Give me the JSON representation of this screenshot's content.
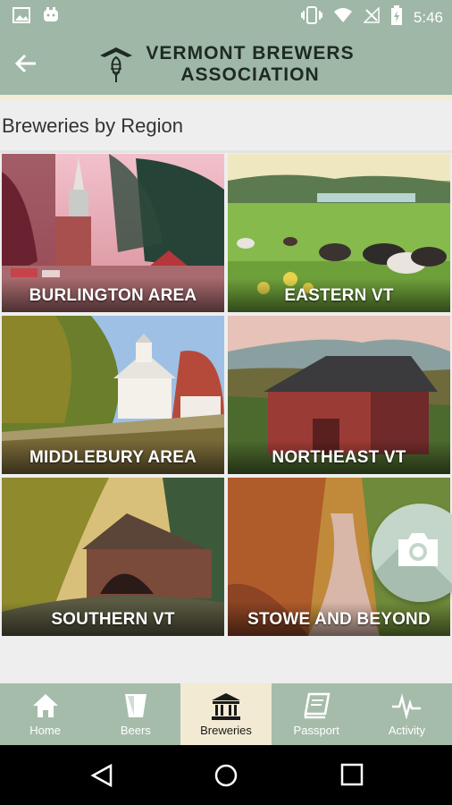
{
  "status_bar": {
    "time": "5:46",
    "icons": [
      "image-icon",
      "notification-app-icon",
      "vibrate-icon",
      "wifi-icon",
      "no-signal-icon",
      "battery-charging-icon"
    ]
  },
  "app_bar": {
    "brand_line1": "VERMONT BREWERS",
    "brand_line2": "ASSOCIATION",
    "back_icon": "arrow-back-icon",
    "logo_icon": "hops-logo-icon"
  },
  "section": {
    "title": "Breweries by Region"
  },
  "regions": [
    {
      "label": "BURLINGTON AREA"
    },
    {
      "label": "EASTERN VT"
    },
    {
      "label": "MIDDLEBURY AREA"
    },
    {
      "label": "NORTHEAST VT"
    },
    {
      "label": "SOUTHERN VT"
    },
    {
      "label": "STOWE AND BEYOND"
    }
  ],
  "fab": {
    "icon": "camera-icon"
  },
  "bottom_nav": {
    "active": "Breweries",
    "items": [
      {
        "label": "Home",
        "icon": "home-icon"
      },
      {
        "label": "Beers",
        "icon": "beer-glass-icon"
      },
      {
        "label": "Breweries",
        "icon": "building-icon"
      },
      {
        "label": "Passport",
        "icon": "passport-book-icon"
      },
      {
        "label": "Activity",
        "icon": "activity-pulse-icon"
      }
    ]
  },
  "colors": {
    "app_bar": "#9fb7a6",
    "accent_stripe": "#f3ecd6",
    "bottom_nav": "#a6bcaa",
    "bottom_nav_active": "#f2ead3",
    "fab": "#c3d6c9"
  }
}
